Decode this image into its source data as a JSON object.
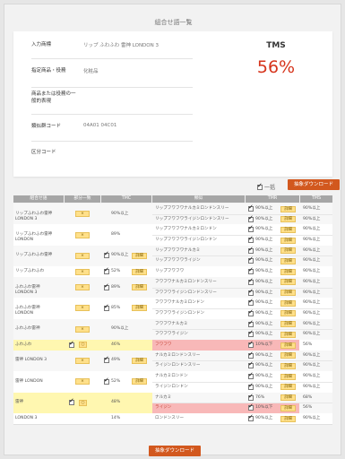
{
  "page_title": "組合せ語一覧",
  "info": [
    {
      "label": "入力商標",
      "value": "リップ ふわふわ 雷神 LONDON 3"
    },
    {
      "label": "指定商品・役務",
      "value": "化粧品"
    },
    {
      "label": "商品または役務の一般的表現",
      "value": ""
    },
    {
      "label": "類似群コード",
      "value": "04A01 04C01"
    },
    {
      "label": "区分コード",
      "value": ""
    }
  ],
  "tms": {
    "label": "TMS",
    "value": "56%"
  },
  "select_all_label": "一括",
  "download_label": "抽象ダウンロード",
  "table": {
    "headers": [
      "組合せ語",
      "部分一致",
      "TMC",
      "類似",
      "TMR",
      "TMS"
    ],
    "rows": [
      {
        "term": "リップふわふわ雷神LONDON 3",
        "partial": "×",
        "tmc": "90%以上",
        "tmc_checked": false,
        "tmc_detail": false,
        "hl": false,
        "sub": [
          {
            "sim": "リップフワフワナルカミロンドンスリー",
            "tmr": "90%以上",
            "detail": "詳細",
            "tms": "90%以上",
            "red": false
          },
          {
            "sim": "リップフワフワライジンロンドンスリー",
            "tmr": "90%以上",
            "detail": "詳細",
            "tms": "90%以上",
            "red": false
          }
        ]
      },
      {
        "term": "リップふわふわ雷神LONDON",
        "partial": "×",
        "tmc": "89%",
        "tmc_checked": false,
        "tmc_detail": false,
        "hl": false,
        "sub": [
          {
            "sim": "リップフワフワナルカミロンドン",
            "tmr": "90%以上",
            "detail": "詳細",
            "tms": "90%以上",
            "red": false
          },
          {
            "sim": "リップフワフワライジンロンドン",
            "tmr": "90%以上",
            "detail": "詳細",
            "tms": "90%以上",
            "red": false
          }
        ]
      },
      {
        "term": "リップふわふわ雷神",
        "partial": "×",
        "tmc": "90%以上",
        "tmc_checked": true,
        "tmc_detail": true,
        "hl": false,
        "sub": [
          {
            "sim": "リップフワフワナルカミ",
            "tmr": "90%以上",
            "detail": "詳細",
            "tms": "90%以上",
            "red": false
          },
          {
            "sim": "リップフワフワライジン",
            "tmr": "90%以上",
            "detail": "詳細",
            "tms": "90%以上",
            "red": false
          }
        ]
      },
      {
        "term": "リップふわふわ",
        "partial": "×",
        "tmc": "52%",
        "tmc_checked": true,
        "tmc_detail": true,
        "hl": false,
        "sub": [
          {
            "sim": "リップフワフワ",
            "tmr": "90%以上",
            "detail": "詳細",
            "tms": "90%以上",
            "red": false
          }
        ]
      },
      {
        "term": "ふわふわ雷神LONDON 3",
        "partial": "×",
        "tmc": "89%",
        "tmc_checked": true,
        "tmc_detail": true,
        "hl": false,
        "sub": [
          {
            "sim": "フワフワナルカミロンドンスリー",
            "tmr": "90%以上",
            "detail": "詳細",
            "tms": "90%以上",
            "red": false
          },
          {
            "sim": "フワフワライジンロンドンスリー",
            "tmr": "90%以上",
            "detail": "詳細",
            "tms": "90%以上",
            "red": false
          }
        ]
      },
      {
        "term": "ふわふわ雷神LONDON",
        "partial": "×",
        "tmc": "85%",
        "tmc_checked": true,
        "tmc_detail": true,
        "hl": false,
        "sub": [
          {
            "sim": "フワフワナルカミロンドン",
            "tmr": "90%以上",
            "detail": "詳細",
            "tms": "90%以上",
            "red": false
          },
          {
            "sim": "フワフワライジンロンドン",
            "tmr": "90%以上",
            "detail": "詳細",
            "tms": "90%以上",
            "red": false
          }
        ]
      },
      {
        "term": "ふわふわ雷神",
        "partial": "×",
        "tmc": "90%以上",
        "tmc_checked": false,
        "tmc_detail": false,
        "hl": false,
        "sub": [
          {
            "sim": "フワフワナルカミ",
            "tmr": "90%以上",
            "detail": "詳細",
            "tms": "90%以上",
            "red": false
          },
          {
            "sim": "フワフワライジン",
            "tmr": "90%以上",
            "detail": "詳細",
            "tms": "90%以上",
            "red": false
          }
        ]
      },
      {
        "term": "ふわふわ",
        "partial": "○",
        "tmc": "46%",
        "tmc_checked": false,
        "tmc_detail": false,
        "hl": true,
        "sub": [
          {
            "sim": "フワフワ",
            "tmr": "10%以下",
            "detail": "詳細",
            "tms": "56%",
            "red": true
          }
        ]
      },
      {
        "term": "雷神 LONDON 3",
        "partial": "×",
        "tmc": "49%",
        "tmc_checked": true,
        "tmc_detail": true,
        "hl": false,
        "sub": [
          {
            "sim": "ナルカミロンドンスリー",
            "tmr": "90%以上",
            "detail": "詳細",
            "tms": "90%以上",
            "red": false
          },
          {
            "sim": "ライジンロンドンスリー",
            "tmr": "90%以上",
            "detail": "詳細",
            "tms": "90%以上",
            "red": false
          }
        ]
      },
      {
        "term": "雷神 LONDON",
        "partial": "×",
        "tmc": "52%",
        "tmc_checked": true,
        "tmc_detail": true,
        "hl": false,
        "sub": [
          {
            "sim": "ナルカミロンドン",
            "tmr": "90%以上",
            "detail": "詳細",
            "tms": "90%以上",
            "red": false
          },
          {
            "sim": "ライジンロンドン",
            "tmr": "90%以上",
            "detail": "詳細",
            "tms": "90%以上",
            "red": false
          }
        ]
      },
      {
        "term": "雷神",
        "partial": "○",
        "tmc": "48%",
        "tmc_checked": false,
        "tmc_detail": false,
        "hl": true,
        "sub": [
          {
            "sim": "ナルカミ",
            "tmr": "76%",
            "detail": "詳細",
            "tms": "68%",
            "red": false
          },
          {
            "sim": "ライジン",
            "tmr": "10%以下",
            "detail": "詳細",
            "tms": "56%",
            "red": true
          }
        ]
      },
      {
        "term": "LONDON 3",
        "partial": "",
        "tmc": "14%",
        "tmc_checked": false,
        "tmc_detail": false,
        "hl": false,
        "sub": [
          {
            "sim": "ロンドンスリー",
            "tmr": "90%以上",
            "detail": "詳細",
            "tms": "90%以上",
            "red": false
          }
        ]
      }
    ]
  }
}
